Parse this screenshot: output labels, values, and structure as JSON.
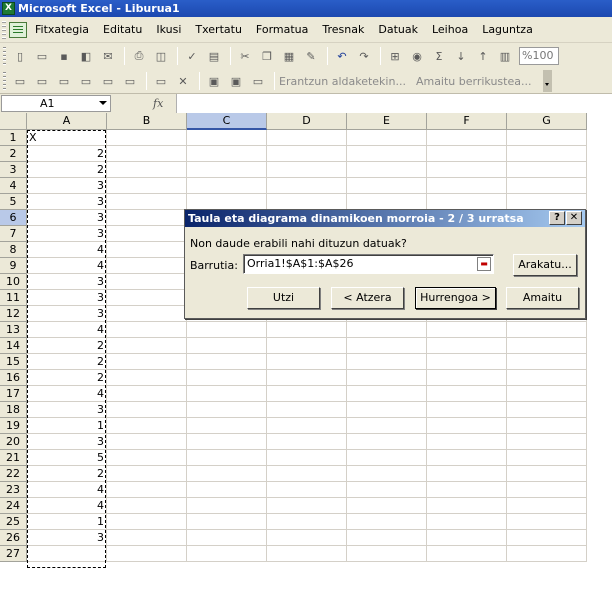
{
  "window": {
    "title": "Microsoft Excel - Liburua1",
    "icon": "excel-icon"
  },
  "menu": [
    "Fitxategia",
    "Editatu",
    "Ikusi",
    "Txertatu",
    "Formatua",
    "Tresnak",
    "Datuak",
    "Leihoa",
    "Laguntza"
  ],
  "toolbar1": {
    "icons": [
      "new-document-icon",
      "open-folder-icon",
      "save-icon",
      "permission-icon",
      "email-icon",
      "print-icon",
      "print-preview-icon",
      "spelling-icon",
      "research-icon",
      "cut-icon",
      "copy-icon",
      "paste-icon",
      "format-painter-icon",
      "undo-icon",
      "redo-icon",
      "hyperlink-icon",
      "chart-icon",
      "autosum-icon",
      "sort-ascending-icon",
      "sort-descending-icon",
      "chart-wizard-icon"
    ],
    "zoom": "%100"
  },
  "toolbar2": {
    "icons": [
      "comment-icon",
      "edit-comment-icon",
      "previous-comment-icon",
      "next-comment-icon",
      "show-comment-icon",
      "show-all-comments-icon",
      "delete-comment-icon",
      "track-changes-icon",
      "reviewing-pane-icon"
    ],
    "reply_label": "Erantzun aldaketekin...",
    "end_review_label": "Amaitu berrikustea..."
  },
  "formula_bar": {
    "name_box": "A1",
    "fx_label": "fx",
    "content": ""
  },
  "grid": {
    "columns": [
      "A",
      "B",
      "C",
      "D",
      "E",
      "F",
      "G"
    ],
    "selected_column": "C",
    "selected_row": 6,
    "rows": [
      {
        "n": "1",
        "a": "X"
      },
      {
        "n": "2",
        "a": "2"
      },
      {
        "n": "3",
        "a": "2"
      },
      {
        "n": "4",
        "a": "3"
      },
      {
        "n": "5",
        "a": "3"
      },
      {
        "n": "6",
        "a": "3"
      },
      {
        "n": "7",
        "a": "3"
      },
      {
        "n": "8",
        "a": "4"
      },
      {
        "n": "9",
        "a": "4"
      },
      {
        "n": "10",
        "a": "3"
      },
      {
        "n": "11",
        "a": "3"
      },
      {
        "n": "12",
        "a": "3"
      },
      {
        "n": "13",
        "a": "4"
      },
      {
        "n": "14",
        "a": "2"
      },
      {
        "n": "15",
        "a": "2"
      },
      {
        "n": "16",
        "a": "2"
      },
      {
        "n": "17",
        "a": "4"
      },
      {
        "n": "18",
        "a": "3"
      },
      {
        "n": "19",
        "a": "1"
      },
      {
        "n": "20",
        "a": "3"
      },
      {
        "n": "21",
        "a": "5"
      },
      {
        "n": "22",
        "a": "2"
      },
      {
        "n": "23",
        "a": "4"
      },
      {
        "n": "24",
        "a": "4"
      },
      {
        "n": "25",
        "a": "1"
      },
      {
        "n": "26",
        "a": "3"
      },
      {
        "n": "27",
        "a": ""
      }
    ]
  },
  "dialog": {
    "title": "Taula eta diagrama dinamikoen morroia - 2 / 3 urratsa",
    "help": "?",
    "close": "✕",
    "question": "Non daude erabili nahi dituzun datuak?",
    "range_label": "Barrutia:",
    "range_value": "Orria1!$A$1:$A$26",
    "browse": "Arakatu...",
    "cancel": "Utzi",
    "back": "< Atzera",
    "next": "Hurrengoa >",
    "finish": "Amaitu"
  }
}
